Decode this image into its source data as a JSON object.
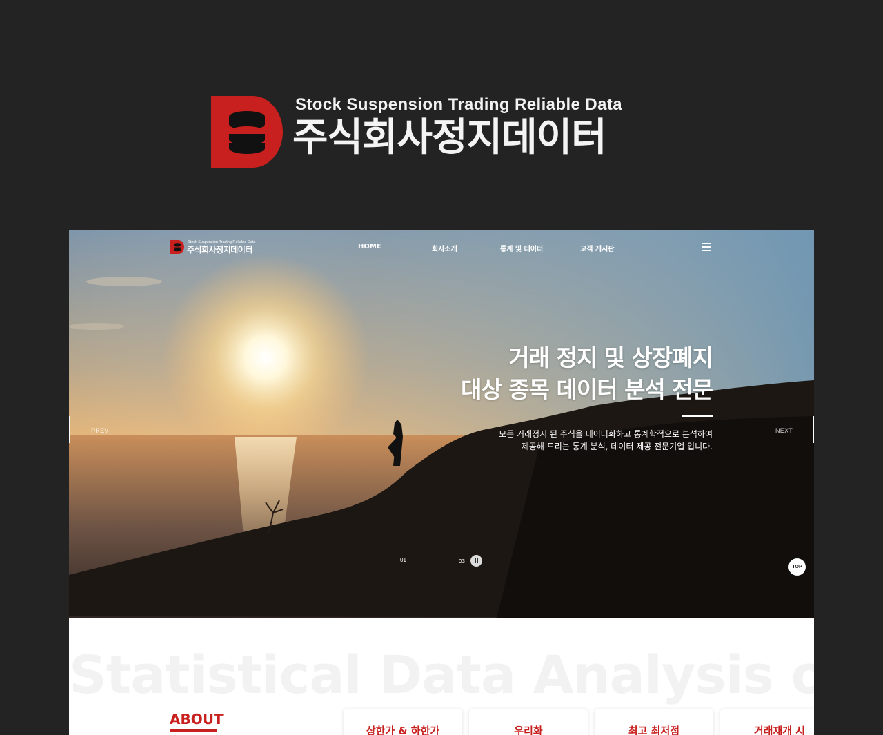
{
  "brand": {
    "tagline": "Stock Suspension Trading Reliable Data",
    "name": "주식회사정지데이터",
    "accent_color": "#c8201e"
  },
  "site": {
    "header": {
      "logo_tagline": "Stock Suspension Trading Reliable Data",
      "logo_name": "주식회사정지데이터",
      "nav": [
        "HOME",
        "회사소개",
        "통계 및 데이터",
        "고객 게시판"
      ],
      "menu_icon": "hamburger-menu-icon"
    },
    "hero": {
      "title_lines": [
        "거래 정지 및 상장폐지",
        "대상 종목 데이터 분석 전문"
      ],
      "description_lines": [
        "모든 거래정지 된 주식을 데이터화하고 통계학적으로 분석하여",
        "제공해 드리는 통계 분석, 데이터 제공 전문기업 입니다."
      ],
      "prev_label": "PREV",
      "next_label": "NEXT",
      "pager": {
        "current": "01",
        "total": "03",
        "progress": 1.0
      },
      "pause_icon": "pause-icon",
      "top_label": "TOP"
    },
    "section": {
      "watermark": "Statistical Data Analysis of",
      "about_label": "ABOUT",
      "cards": [
        "상한가 & 하한가",
        "우리화",
        "최고 최저점",
        "거래재개 시"
      ]
    }
  }
}
